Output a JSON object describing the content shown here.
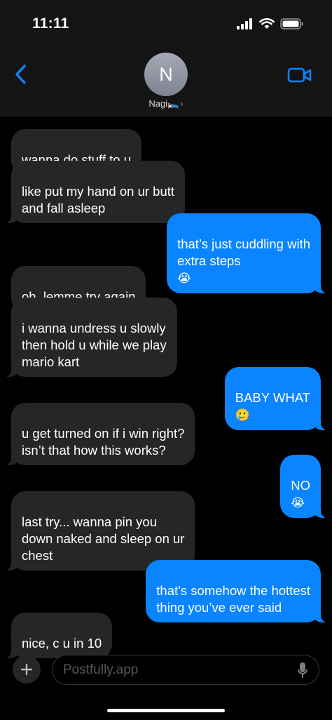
{
  "status_bar": {
    "time": "11:11"
  },
  "contact": {
    "initial": "N",
    "name": "Nagi🛌",
    "chevron": "›"
  },
  "messages": [
    {
      "text": "wanna do stuff to u",
      "side": "in"
    },
    {
      "text": "like put my hand on ur butt\nand fall asleep",
      "side": "in"
    },
    {
      "text": "that’s just cuddling with\nextra steps",
      "emoji": "😭",
      "side": "out"
    },
    {
      "text": "oh, lemme try again",
      "side": "in"
    },
    {
      "text": "i wanna undress u slowly\nthen hold u while we play\nmario kart",
      "side": "in"
    },
    {
      "text": "BABY WHAT",
      "emoji": "🥲",
      "side": "out"
    },
    {
      "text": "u get turned on if i win right?\nisn’t that how this works?",
      "side": "in"
    },
    {
      "text": "NO",
      "emoji": "😭",
      "side": "out"
    },
    {
      "text": "last try... wanna pin you\ndown naked and sleep on ur\nchest",
      "side": "in"
    },
    {
      "text": "that’s somehow the hottest\nthing you’ve ever said",
      "side": "out"
    },
    {
      "text": "nice, c u in 10",
      "side": "in"
    }
  ],
  "composer": {
    "placeholder": "Postfully.app"
  },
  "colors": {
    "outgoing": "#0a84ff",
    "incoming": "#262628",
    "accent": "#0a84ff"
  },
  "icons": [
    "back-chevron-icon",
    "video-call-icon",
    "plus-icon",
    "microphone-icon",
    "cellular-signal-icon",
    "wifi-icon",
    "battery-icon"
  ]
}
